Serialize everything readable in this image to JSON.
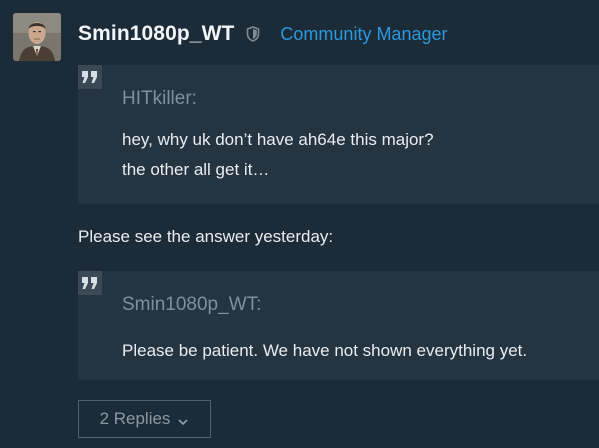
{
  "post": {
    "author_name": "Smin1080p_WT",
    "author_role": "Community Manager",
    "avatar_icon": "user-portrait-avatar",
    "shield_icon": "shield-icon",
    "quotes": [
      {
        "author": "HITkiller:",
        "lines": [
          "hey, why uk don’t have ah64e this major?",
          "the other all get it…"
        ]
      },
      {
        "author": "Smin1080p_WT:",
        "lines": [
          "Please be patient. We have not shown everything yet."
        ]
      }
    ],
    "body_text": "Please see the answer yesterday:",
    "replies_label": "2 Replies",
    "replies_icon": "chevron-down-icon"
  },
  "colors": {
    "background": "#1c2b38",
    "quote_background": "#243441",
    "role_color": "#2b98dd",
    "muted_text": "#7f909c"
  }
}
